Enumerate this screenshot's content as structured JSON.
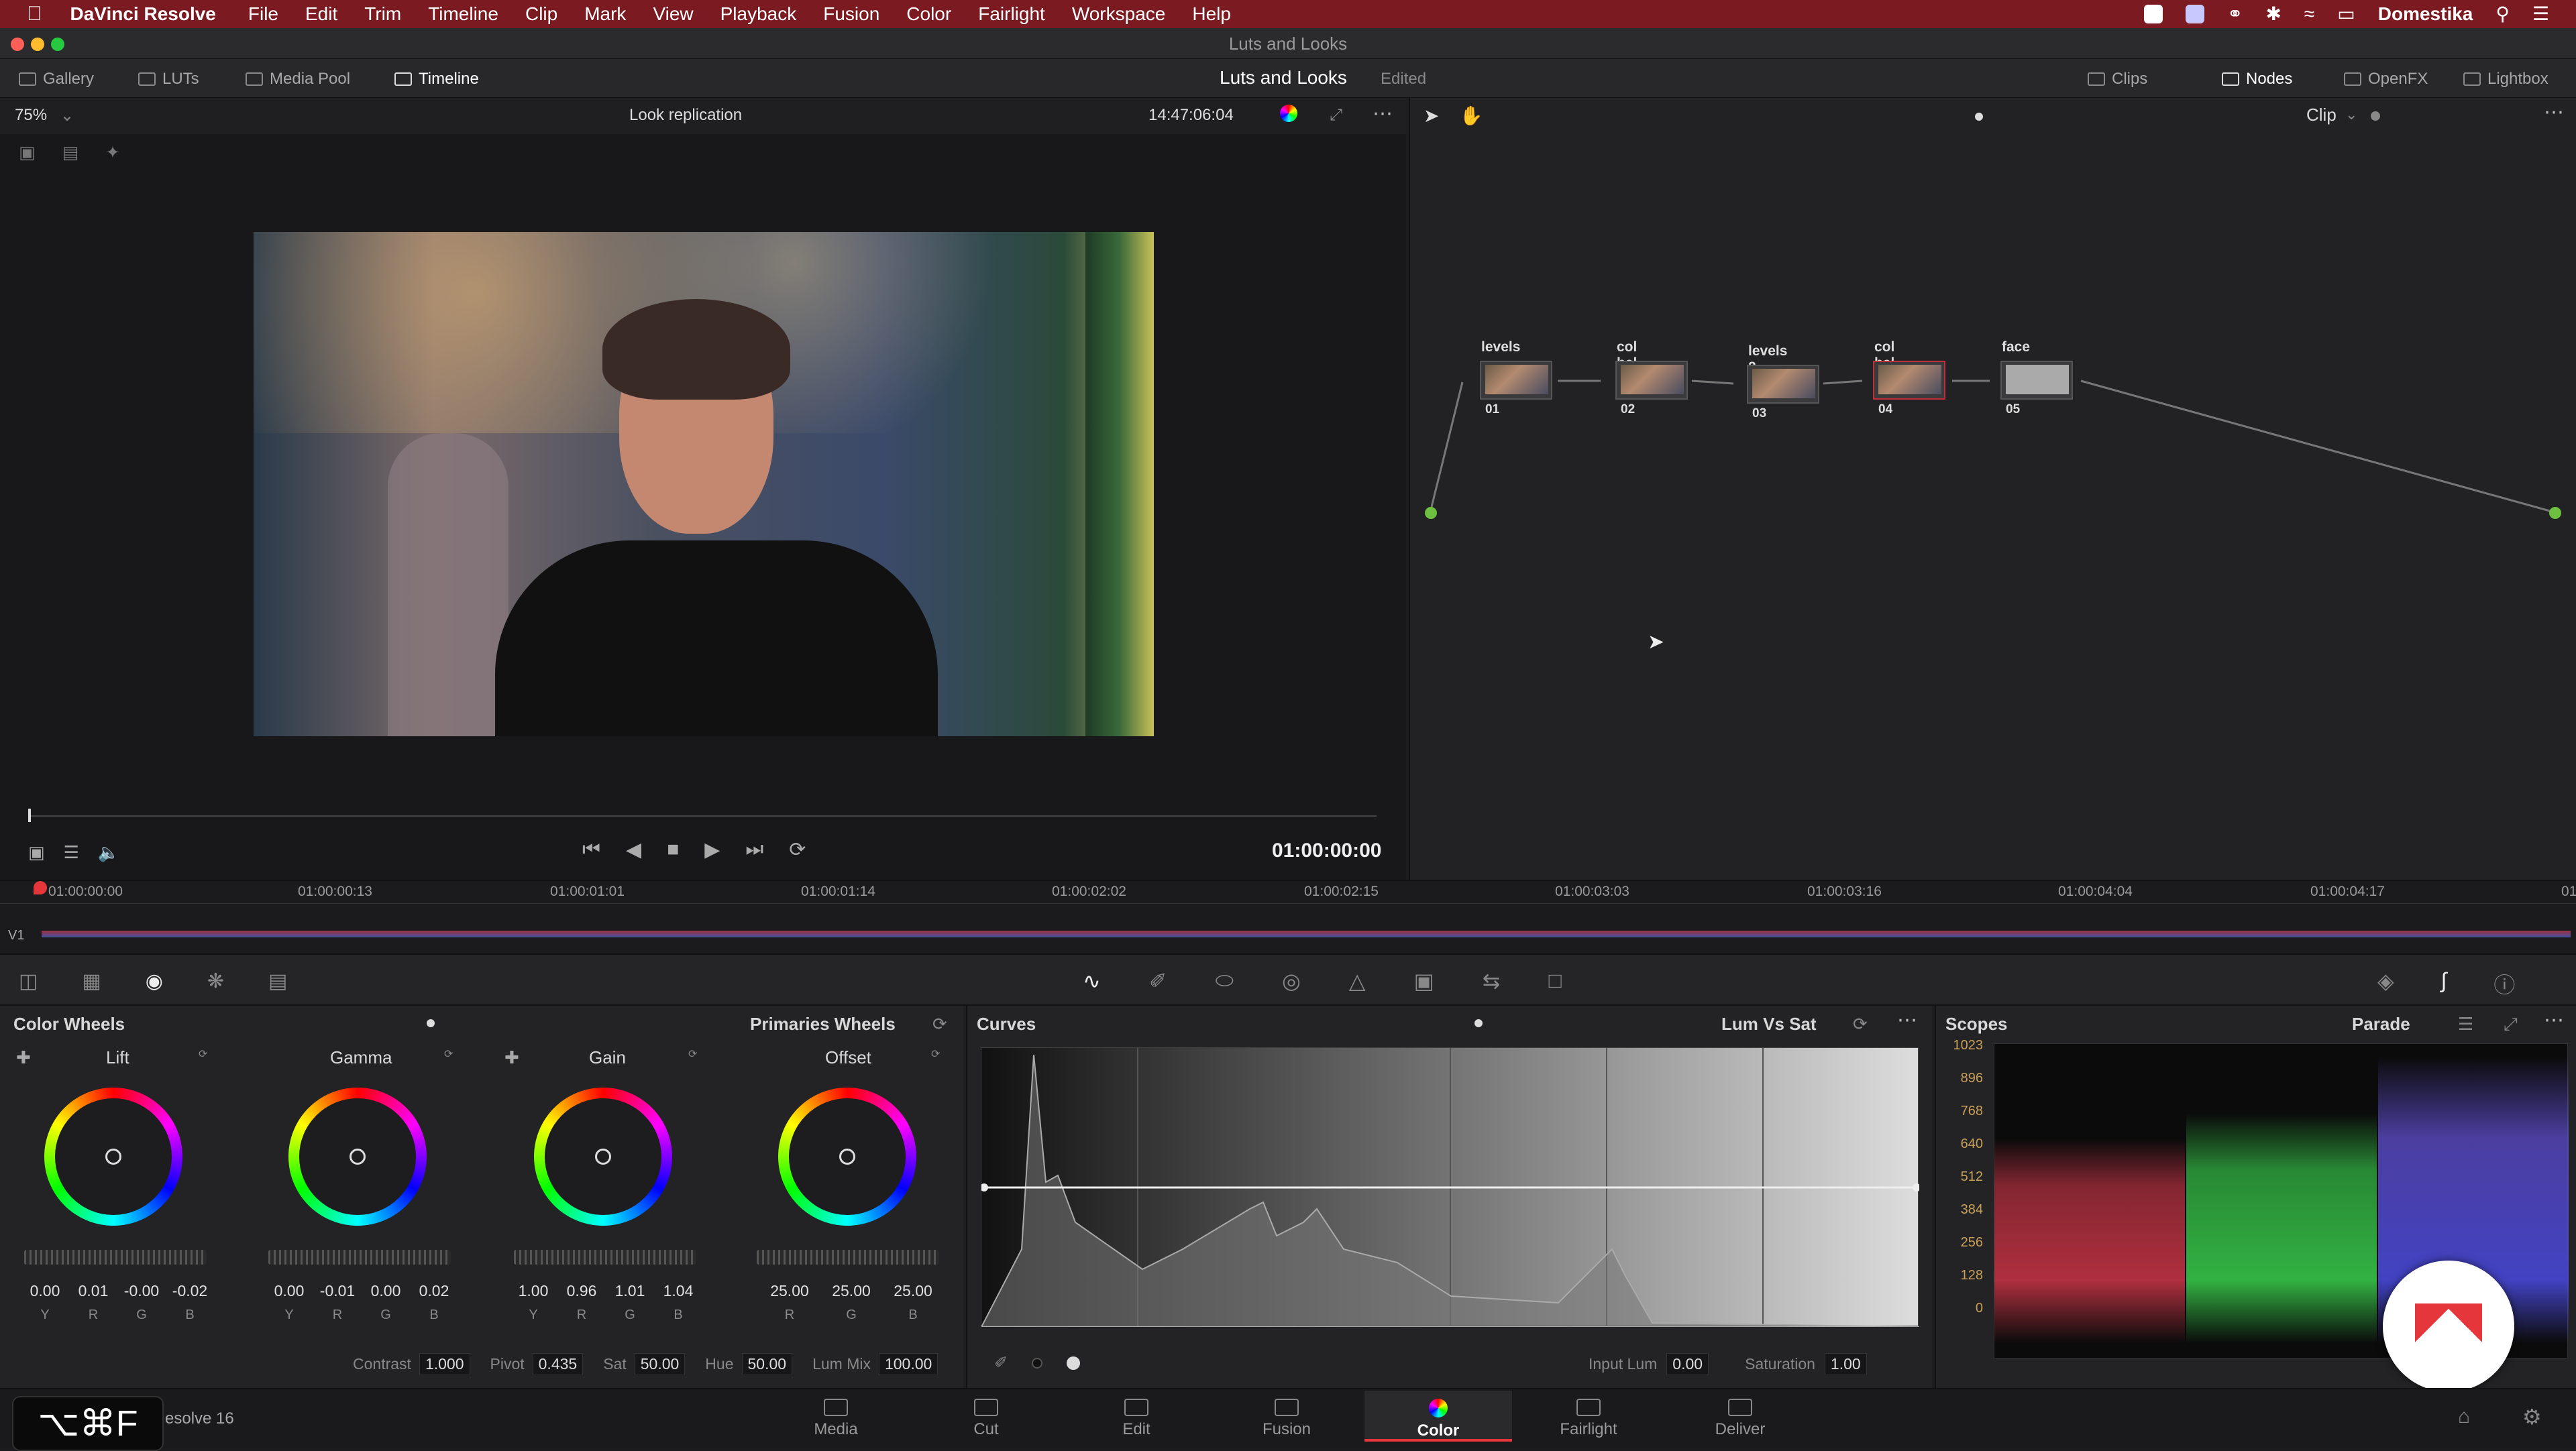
{
  "menubar": {
    "app_name": "DaVinci Resolve",
    "items": [
      "File",
      "Edit",
      "Trim",
      "Timeline",
      "Clip",
      "Mark",
      "View",
      "Playback",
      "Fusion",
      "Color",
      "Fairlight",
      "Workspace",
      "Help"
    ],
    "user": "Domestika"
  },
  "window": {
    "title": "Luts and Looks"
  },
  "toolbar": {
    "left": [
      "Gallery",
      "LUTs",
      "Media Pool",
      "Timeline"
    ],
    "project": "Luts and Looks",
    "status": "Edited",
    "right": [
      "Clips",
      "Nodes",
      "OpenFX",
      "Lightbox"
    ]
  },
  "viewer": {
    "zoom": "75%",
    "look": "Look replication",
    "timecode": "14:47:06:04",
    "current_tc": "01:00:00:00",
    "node_mode": "Clip"
  },
  "nodes": [
    {
      "label": "levels",
      "id": "01"
    },
    {
      "label": "col bal",
      "id": "02"
    },
    {
      "label": "levels 2",
      "id": "03"
    },
    {
      "label": "col bal 2",
      "id": "04"
    },
    {
      "label": "face",
      "id": "05"
    }
  ],
  "timeline": {
    "track": "V1",
    "ticks": [
      "01:00:00:00",
      "01:00:00:13",
      "01:00:01:01",
      "01:00:01:14",
      "01:00:02:02",
      "01:00:02:15",
      "01:00:03:03",
      "01:00:03:16",
      "01:00:04:04",
      "01:00:04:17",
      "01"
    ]
  },
  "color_wheels": {
    "title": "Color Wheels",
    "mode": "Primaries Wheels",
    "wheels": [
      {
        "name": "Lift",
        "values": [
          "0.00",
          "0.01",
          "-0.00",
          "-0.02"
        ],
        "channels": [
          "Y",
          "R",
          "G",
          "B"
        ]
      },
      {
        "name": "Gamma",
        "values": [
          "0.00",
          "-0.01",
          "0.00",
          "0.02"
        ],
        "channels": [
          "Y",
          "R",
          "G",
          "B"
        ]
      },
      {
        "name": "Gain",
        "values": [
          "1.00",
          "0.96",
          "1.01",
          "1.04"
        ],
        "channels": [
          "Y",
          "R",
          "G",
          "B"
        ]
      },
      {
        "name": "Offset",
        "values": [
          "25.00",
          "25.00",
          "25.00"
        ],
        "channels": [
          "R",
          "G",
          "B"
        ]
      }
    ],
    "adjust": [
      {
        "label": "Contrast",
        "value": "1.000"
      },
      {
        "label": "Pivot",
        "value": "0.435"
      },
      {
        "label": "Sat",
        "value": "50.00"
      },
      {
        "label": "Hue",
        "value": "50.00"
      },
      {
        "label": "Lum Mix",
        "value": "100.00"
      }
    ]
  },
  "curves": {
    "title": "Curves",
    "mode": "Lum Vs Sat",
    "input_lum_label": "Input Lum",
    "input_lum": "0.00",
    "saturation_label": "Saturation",
    "saturation": "1.00"
  },
  "scopes": {
    "title": "Scopes",
    "mode": "Parade",
    "scale": [
      "1023",
      "896",
      "768",
      "640",
      "512",
      "384",
      "256",
      "128",
      "0"
    ]
  },
  "pages": [
    {
      "label": "Media",
      "icon": "media-page-icon"
    },
    {
      "label": "Cut",
      "icon": "cut-page-icon"
    },
    {
      "label": "Edit",
      "icon": "edit-page-icon"
    },
    {
      "label": "Fusion",
      "icon": "fusion-page-icon"
    },
    {
      "label": "Color",
      "icon": "color-page-icon",
      "active": true
    },
    {
      "label": "Fairlight",
      "icon": "fairlight-page-icon"
    },
    {
      "label": "Deliver",
      "icon": "deliver-page-icon"
    }
  ],
  "footer": {
    "version": "esolve 16",
    "shortcut": "⌥⌘F"
  },
  "colors": {
    "accent": "#e5363c",
    "menubar": "#7c1a22"
  }
}
